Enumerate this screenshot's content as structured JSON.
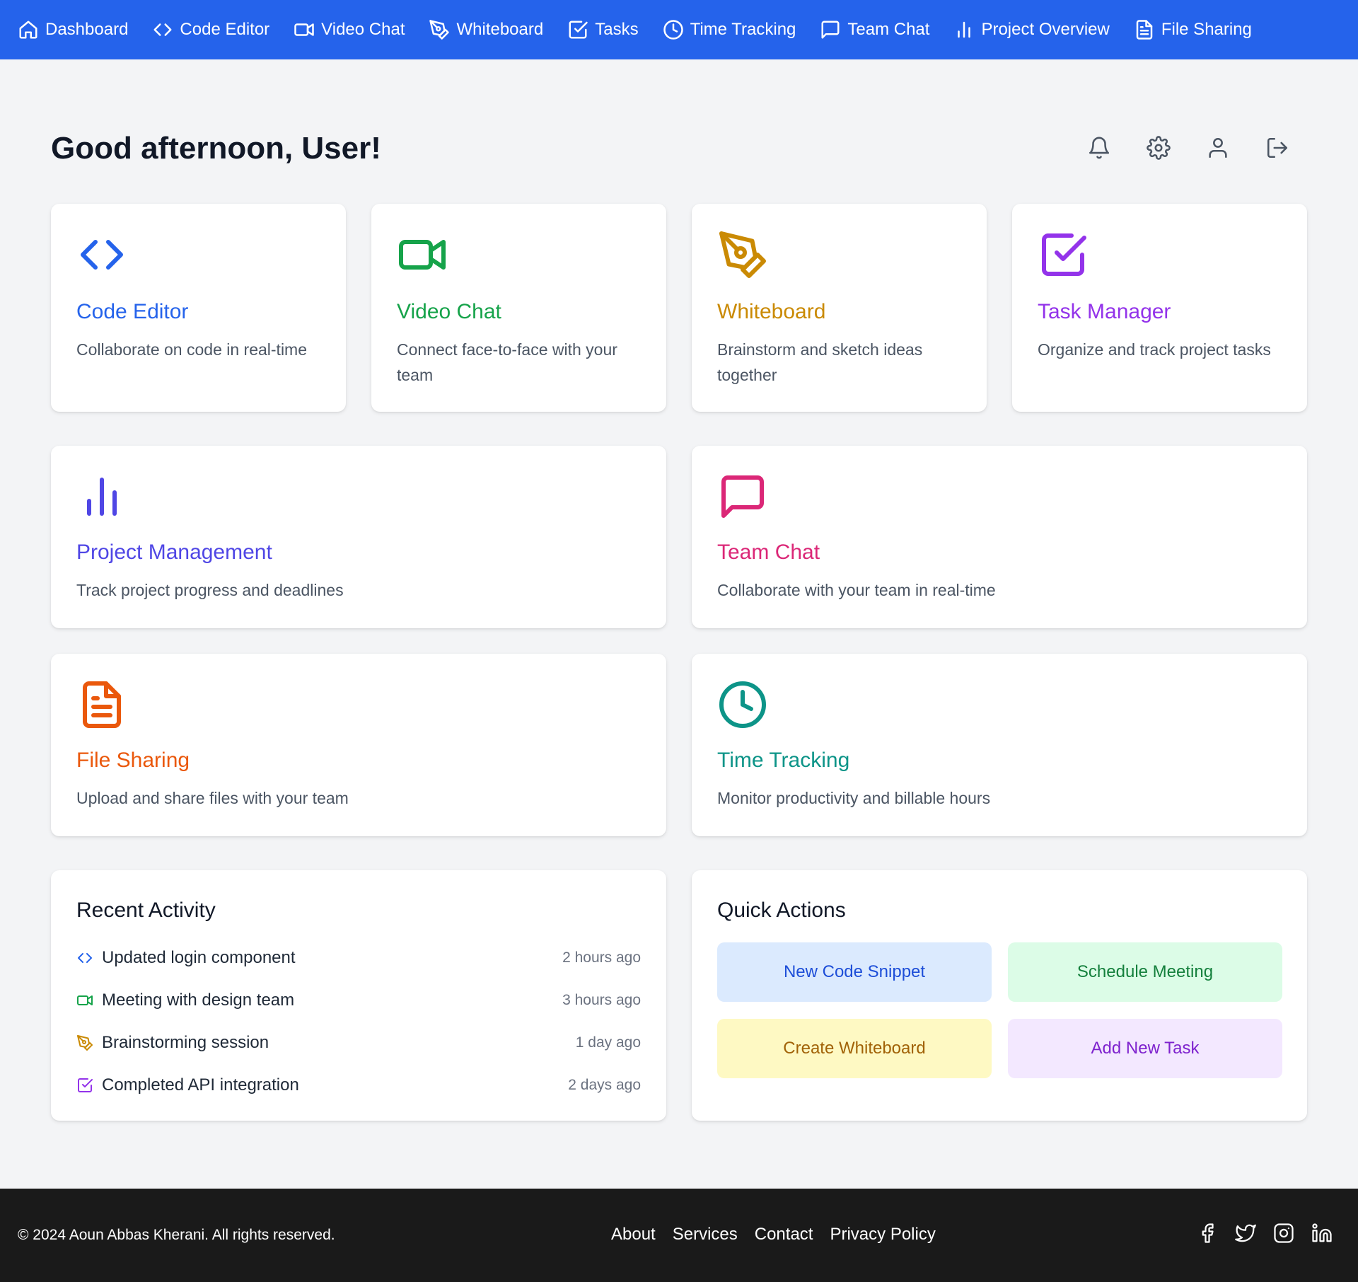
{
  "nav": {
    "items": [
      {
        "label": "Dashboard",
        "icon": "home-icon"
      },
      {
        "label": "Code Editor",
        "icon": "code-icon"
      },
      {
        "label": "Video Chat",
        "icon": "video-icon"
      },
      {
        "label": "Whiteboard",
        "icon": "pen-tool-icon"
      },
      {
        "label": "Tasks",
        "icon": "check-square-icon"
      },
      {
        "label": "Time Tracking",
        "icon": "clock-icon"
      },
      {
        "label": "Team Chat",
        "icon": "message-square-icon"
      },
      {
        "label": "Project Overview",
        "icon": "bar-chart-icon"
      },
      {
        "label": "File Sharing",
        "icon": "file-text-icon"
      }
    ]
  },
  "header": {
    "greeting": "Good afternoon, User!",
    "icons": [
      "bell-icon",
      "settings-icon",
      "user-icon",
      "logout-icon"
    ]
  },
  "features": [
    {
      "title": "Code Editor",
      "description": "Collaborate on code in real-time",
      "color": "#2563eb",
      "icon": "code-icon"
    },
    {
      "title": "Video Chat",
      "description": "Connect face-to-face with your team",
      "color": "#16a34a",
      "icon": "video-icon"
    },
    {
      "title": "Whiteboard",
      "description": "Brainstorm and sketch ideas together",
      "color": "#ca8a04",
      "icon": "pen-tool-icon"
    },
    {
      "title": "Task Manager",
      "description": "Organize and track project tasks",
      "color": "#9333ea",
      "icon": "check-square-icon"
    },
    {
      "title": "Project Management",
      "description": "Track project progress and deadlines",
      "color": "#4f46e5",
      "icon": "bar-chart-icon"
    },
    {
      "title": "Team Chat",
      "description": "Collaborate with your team in real-time",
      "color": "#db2777",
      "icon": "message-square-icon"
    },
    {
      "title": "File Sharing",
      "description": "Upload and share files with your team",
      "color": "#ea580c",
      "icon": "file-text-icon"
    },
    {
      "title": "Time Tracking",
      "description": "Monitor productivity and billable hours",
      "color": "#0d9488",
      "icon": "clock-icon"
    }
  ],
  "recent_activity": {
    "title": "Recent Activity",
    "items": [
      {
        "text": "Updated login component",
        "time": "2 hours ago",
        "icon": "code-icon",
        "color": "#2563eb"
      },
      {
        "text": "Meeting with design team",
        "time": "3 hours ago",
        "icon": "video-icon",
        "color": "#16a34a"
      },
      {
        "text": "Brainstorming session",
        "time": "1 day ago",
        "icon": "pen-tool-icon",
        "color": "#ca8a04"
      },
      {
        "text": "Completed API integration",
        "time": "2 days ago",
        "icon": "check-square-icon",
        "color": "#9333ea"
      }
    ]
  },
  "quick_actions": {
    "title": "Quick Actions",
    "buttons": [
      {
        "label": "New Code Snippet",
        "bg": "#dbeafe",
        "fg": "#1d4ed8"
      },
      {
        "label": "Schedule Meeting",
        "bg": "#dcfce7",
        "fg": "#15803d"
      },
      {
        "label": "Create Whiteboard",
        "bg": "#fef9c3",
        "fg": "#a16207"
      },
      {
        "label": "Add New Task",
        "bg": "#f3e8ff",
        "fg": "#7e22ce"
      }
    ]
  },
  "footer": {
    "copyright": "© 2024 Aoun Abbas Kherani. All rights reserved.",
    "links": [
      "About",
      "Services",
      "Contact",
      "Privacy Policy"
    ],
    "social": [
      "facebook-icon",
      "twitter-icon",
      "instagram-icon",
      "linkedin-icon"
    ]
  }
}
